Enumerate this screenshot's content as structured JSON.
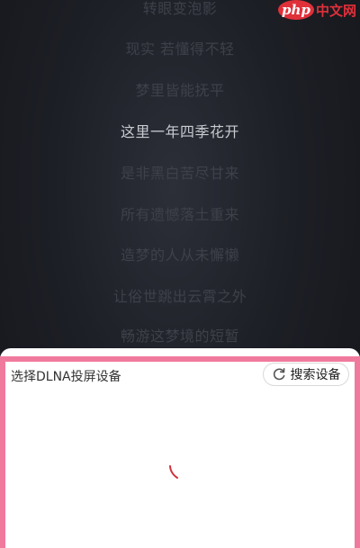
{
  "lyrics": [
    "转眼变泡影",
    "现实 若懂得不轻",
    "梦里皆能抚平",
    "这里一年四季花开",
    "是非黑白苦尽甘来",
    "所有遗憾落土重来",
    "造梦的人从未懈懒",
    "让俗世跳出云霄之外",
    "畅游这梦境的短暂"
  ],
  "current_lyric_index": 3,
  "watermark": {
    "logo": "php",
    "text": "中文网"
  },
  "dlna_sheet": {
    "title": "选择DLNA投屏设备",
    "search_label": "搜索设备",
    "loading": true
  },
  "colors": {
    "accent_frame": "#f07a9d",
    "spinner": "#d0303a",
    "current_lyric": "#c9cbd1",
    "dim_lyric": "#3f414a"
  }
}
